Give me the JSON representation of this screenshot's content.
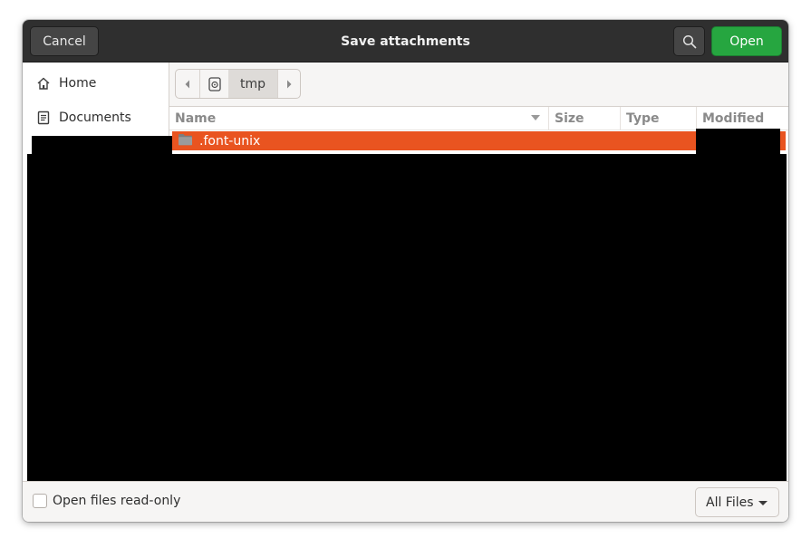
{
  "dialog": {
    "title": "Save attachments"
  },
  "header": {
    "cancel_label": "Cancel",
    "search_icon": "search-icon",
    "open_label": "Open"
  },
  "sidebar": {
    "items": [
      {
        "label": "Home",
        "icon": "home-icon"
      },
      {
        "label": "Documents",
        "icon": "document-icon"
      }
    ]
  },
  "pathbar": {
    "segments": [
      {
        "icon": "chevron-left-icon"
      },
      {
        "icon": "drive-icon"
      },
      {
        "label": "tmp"
      },
      {
        "icon": "chevron-right-icon"
      }
    ]
  },
  "filelist": {
    "columns": [
      "Name",
      "Size",
      "Type",
      "Modified"
    ],
    "sort_column": "Name",
    "rows": [
      {
        "name": ".font-unix",
        "icon": "folder-icon",
        "selected": true
      }
    ]
  },
  "footer": {
    "read_only_label": "Open files read-only",
    "read_only_checked": false,
    "filter_label": "All Files"
  },
  "colors": {
    "accent": "#e95420",
    "open_button": "#26a640",
    "headerbar": "#2f2f2f"
  }
}
